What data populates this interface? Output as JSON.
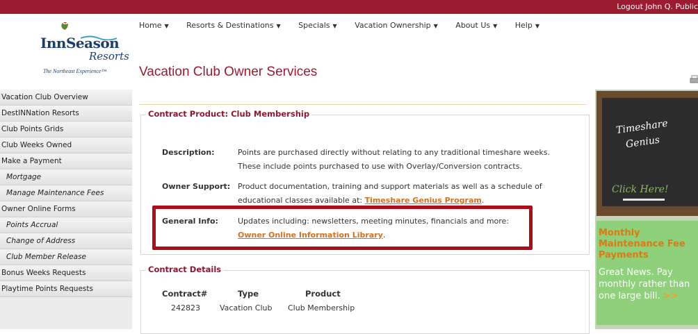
{
  "header": {
    "logout_text": "Logout John Q. Public"
  },
  "logo": {
    "name": "InnSeason",
    "subname": "Resorts",
    "tagline": "The Northeast Experience™"
  },
  "nav": {
    "items": [
      {
        "label": "Home"
      },
      {
        "label": "Resorts & Destinations"
      },
      {
        "label": "Specials"
      },
      {
        "label": "Vacation Ownership"
      },
      {
        "label": "About Us"
      },
      {
        "label": "Help"
      }
    ]
  },
  "page": {
    "title": "Vacation Club Owner Services"
  },
  "sidebar": {
    "items": [
      {
        "label": "Vacation Club Overview"
      },
      {
        "label": "DestINNation Resorts"
      },
      {
        "label": "Club Points Grids"
      },
      {
        "label": "Club Weeks Owned"
      },
      {
        "label": "Make a Payment"
      },
      {
        "label": "Mortgage"
      },
      {
        "label": "Manage Maintenance Fees"
      },
      {
        "label": "Owner Online Forms"
      },
      {
        "label": "Points Accrual"
      },
      {
        "label": "Change of Address"
      },
      {
        "label": "Club Member Release"
      },
      {
        "label": "Bonus Weeks Requests"
      },
      {
        "label": "Playtime Points Requests"
      }
    ]
  },
  "contract_product": {
    "legend": "Contract Product: Club Membership",
    "description_label": "Description:",
    "description_line1": "Points are purchased directly without relating to any traditional timeshare weeks.",
    "description_line2": "These include points purchased to use with Overlay/Conversion contracts.",
    "support_label": "Owner Support:",
    "support_line1": "Product documentation, training and support materials as well as a schedule of",
    "support_line2_prefix": "educational classes available at: ",
    "support_link": "Timeshare Genius Program",
    "support_suffix": ".",
    "general_label": "General Info:",
    "general_line1": "Updates including: newsletters, meeting minutes, financials and more:",
    "general_link": "Owner Online Information Library",
    "general_suffix": "."
  },
  "contract_details": {
    "legend": "Contract Details",
    "headers": [
      "Contract#",
      "Type",
      "Product"
    ],
    "rows": [
      [
        "242823",
        "Vacation Club",
        "Club Membership"
      ]
    ]
  },
  "promo_chalkboard": {
    "line1": "Timeshare",
    "line2": "Genius",
    "cta": "Click Here!"
  },
  "promo_maintenance": {
    "heading": "Monthly Maintenance Fee Payments",
    "body": "Great News. Pay monthly rather than one large bill.",
    "arrow": ">>"
  },
  "colors": {
    "brand": "#9b1b30",
    "link": "#d4711e",
    "highlight": "#ad0f1a"
  }
}
